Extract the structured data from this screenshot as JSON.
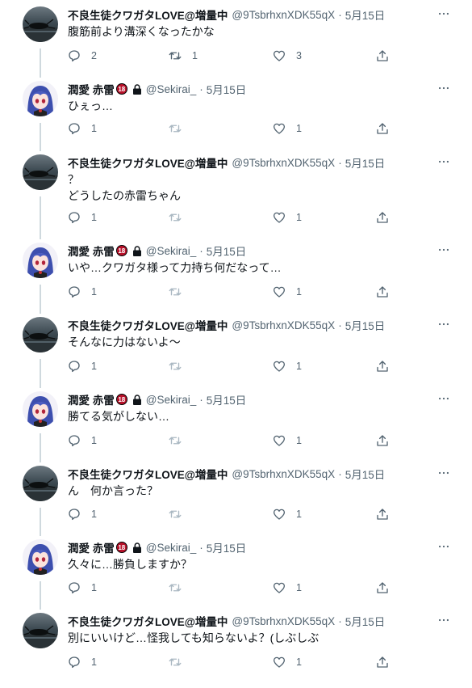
{
  "accounts": {
    "kuwagata": {
      "name": "不良生徒クワガタLOVE@増量中",
      "handle": "@9TsbrhxnXDK55qX",
      "avatar_icon": "beetle-photo-avatar"
    },
    "sekirai": {
      "name": "潤愛 赤雷",
      "badge": "18",
      "lock_icon": "lock-icon",
      "handle": "@Sekirai_",
      "avatar_icon": "anime-girl-avatar"
    }
  },
  "separator": "·",
  "tweets": [
    {
      "author": "kuwagata",
      "date": "5月15日",
      "text": "腹筋前より溝深くなったかな",
      "replies": "2",
      "retweets": "1",
      "likes": "3"
    },
    {
      "author": "sekirai",
      "date": "5月15日",
      "text": "ひぇっ…",
      "replies": "1",
      "retweets": "",
      "likes": "1"
    },
    {
      "author": "kuwagata",
      "date": "5月15日",
      "text": "？\nどうしたの赤雷ちゃん",
      "replies": "1",
      "retweets": "",
      "likes": "1"
    },
    {
      "author": "sekirai",
      "date": "5月15日",
      "text": "いや…クワガタ様って力持ち何だなって…",
      "replies": "1",
      "retweets": "",
      "likes": "1"
    },
    {
      "author": "kuwagata",
      "date": "5月15日",
      "text": "そんなに力はないよ～",
      "replies": "1",
      "retweets": "",
      "likes": "1"
    },
    {
      "author": "sekirai",
      "date": "5月15日",
      "text": "勝てる気がしない…",
      "replies": "1",
      "retweets": "",
      "likes": "1"
    },
    {
      "author": "kuwagata",
      "date": "5月15日",
      "text": "ん　何か言った？",
      "replies": "1",
      "retweets": "",
      "likes": "1"
    },
    {
      "author": "sekirai",
      "date": "5月15日",
      "text": "久々に…勝負しますか？",
      "replies": "1",
      "retweets": "",
      "likes": "1"
    },
    {
      "author": "kuwagata",
      "date": "5月15日",
      "text": "別にいいけど…怪我しても知らないよ？(しぶしぶ",
      "replies": "1",
      "retweets": "",
      "likes": "1"
    }
  ],
  "icons": {
    "more": "more-horizontal-icon",
    "reply": "reply-bubble-icon",
    "retweet": "retweet-icon",
    "like": "heart-icon",
    "share": "share-upload-icon"
  },
  "colors": {
    "text": "#0f1419",
    "secondary": "#536471",
    "thread_line": "#cfd9de",
    "retweet_disabled": "#aab8c2",
    "badge_red": "#b8112a"
  }
}
